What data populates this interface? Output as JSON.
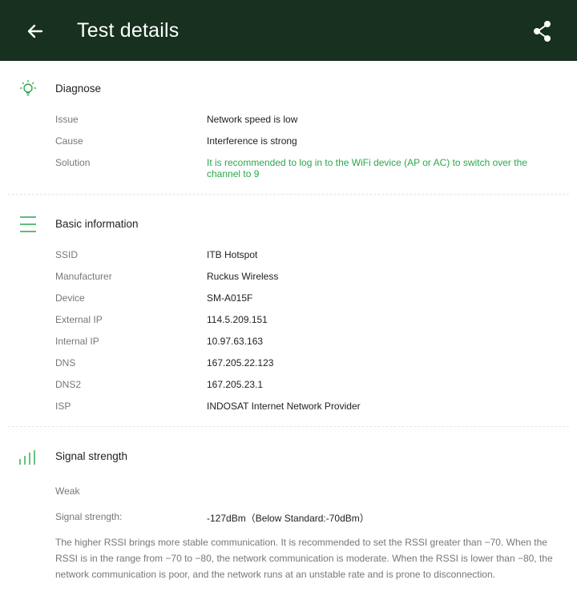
{
  "appbar": {
    "title": "Test details",
    "back_icon": "arrow-left-icon",
    "share_icon": "share-icon"
  },
  "colors": {
    "appbar_bg": "#17301f",
    "accent_green": "#2aa84a"
  },
  "diagnose": {
    "title": "Diagnose",
    "icon": "lightbulb-icon",
    "rows": [
      {
        "label": "Issue",
        "value": "Network speed is low"
      },
      {
        "label": "Cause",
        "value": "Interference is strong"
      },
      {
        "label": "Solution",
        "value": "It is recommended to log in to the WiFi device (AP or AC) to switch over the channel to 9"
      }
    ]
  },
  "basic": {
    "title": "Basic information",
    "icon": "list-icon",
    "rows": [
      {
        "label": "SSID",
        "value": "ITB Hotspot"
      },
      {
        "label": "Manufacturer",
        "value": "Ruckus Wireless"
      },
      {
        "label": "Device",
        "value": "SM-A015F"
      },
      {
        "label": "External IP",
        "value": "114.5.209.151"
      },
      {
        "label": "Internal IP",
        "value": "10.97.63.163"
      },
      {
        "label": "DNS",
        "value": "167.205.22.123"
      },
      {
        "label": "DNS2",
        "value": "167.205.23.1"
      },
      {
        "label": "ISP",
        "value": "INDOSAT Internet Network Provider"
      }
    ]
  },
  "signal": {
    "title": "Signal strength",
    "icon": "signal-bars-icon",
    "level": "Weak",
    "strength_label": "Signal strength:",
    "strength_value": "-127dBm（Below Standard:-70dBm）",
    "note": "The higher RSSI brings more stable communication. It is recommended to set the RSSI greater than −70. When the RSSI is in the range from −70 to −80, the network communication is moderate. When the RSSI is lower than −80, the network communication is poor, and the network runs at an unstable rate and is prone to disconnection."
  }
}
